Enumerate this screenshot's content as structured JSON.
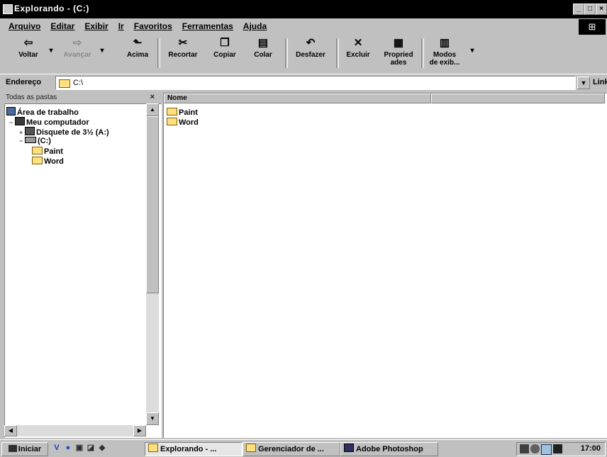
{
  "window": {
    "title": "Explorando - (C:)"
  },
  "menu": {
    "items": [
      "Arquivo",
      "Editar",
      "Exibir",
      "Ir",
      "Favoritos",
      "Ferramentas",
      "Ajuda"
    ]
  },
  "toolbar": {
    "back": "Voltar",
    "forward": "Avançar",
    "up": "Acima",
    "cut": "Recortar",
    "copy": "Copiar",
    "paste": "Colar",
    "undo": "Desfazer",
    "delete": "Excluir",
    "properties_1": "Propried",
    "properties_2": "ades",
    "views_1": "Modos",
    "views_2": "de exib..."
  },
  "address": {
    "label": "Endereço",
    "value": "C:\\",
    "links": "Links"
  },
  "left_pane": {
    "header": "Todas as pastas",
    "close": "×",
    "tree": {
      "desktop": "Área de trabalho",
      "my_computer": "Meu computador",
      "floppy": "Disquete de 3½ (A:)",
      "c_drive": "(C:)",
      "paint": "Paint",
      "word": "Word"
    }
  },
  "right_pane": {
    "columns": [
      "Nome",
      ""
    ],
    "files": [
      "Paint",
      "Word"
    ]
  },
  "taskbar": {
    "start": "Iniciar",
    "tasks": [
      "Explorando - ...",
      "Gerenciador de ...",
      "Adobe Photoshop"
    ],
    "clock": "17:00"
  }
}
